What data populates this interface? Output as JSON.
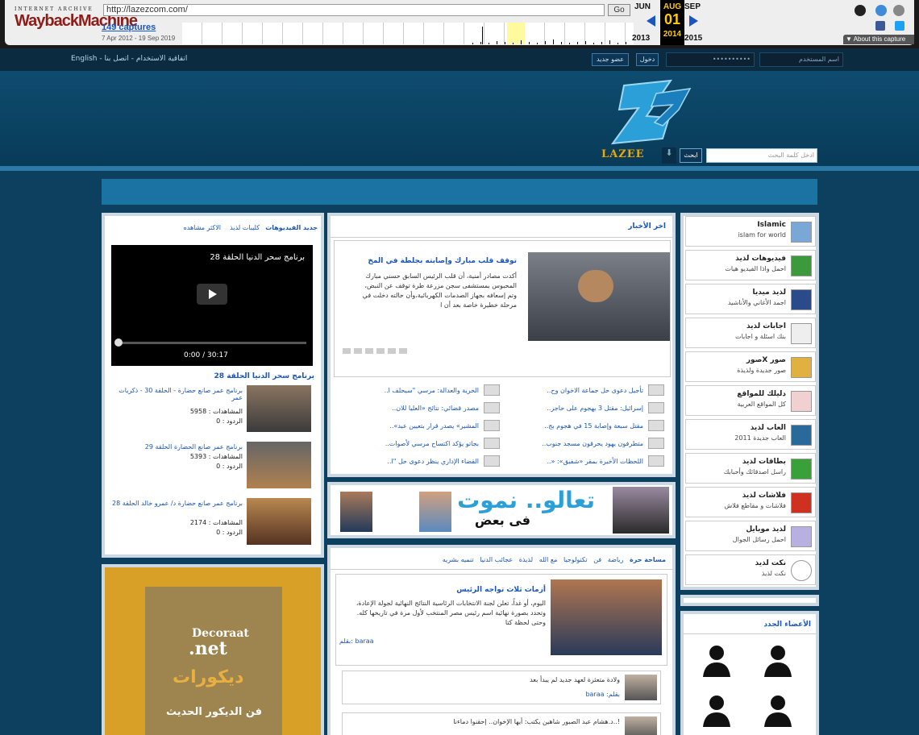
{
  "wayback": {
    "logo_top": "INTERNET ARCHIVE",
    "logo_main": "WaybackMachine",
    "url": "http://lazezcom.com/",
    "go_label": "Go",
    "captures": "149 captures",
    "date_range": "7 Apr 2012 - 19 Sep 2019",
    "month_prev": "JUN",
    "month_cur": "AUG",
    "month_next": "SEP",
    "day": "01",
    "year_prev": "2013",
    "year_cur": "2014",
    "year_next": "2015",
    "about": "▼ About this capture"
  },
  "topbar": {
    "links": "English - اتفاقية الاستخدام - اتصل بنا",
    "username_placeholder": "اسم المستخدم",
    "password_value": "••••••••••",
    "login_label": "دخول",
    "register_label": "عضو جديد"
  },
  "header": {
    "logo_text": "LAZEE",
    "search_placeholder": "ادخل كلمة البحث",
    "search_button": "ابحث"
  },
  "videos": {
    "tabs": [
      "جديد الفيديوهات",
      "كليبات لذيذ",
      "الاكثر مشاهده"
    ],
    "player_title": "برنامج سحر الدنيا الحلقة 28",
    "player_time": "0:00 / 30:17",
    "main_title": "برنامج سحر الدنيا الحلقة 28",
    "items": [
      {
        "title": "برنامج عمر صانع حضارة - الحلقة 30 - ذكريات عمر",
        "views": "المشاهدات : 5958",
        "replies": "الردود : 0"
      },
      {
        "title": "برنامج عمر صانع الحضارة الحلقة 29",
        "views": "المشاهدات : 5393",
        "replies": "الردود : 0"
      },
      {
        "title": "برنامج عمر صانع حضارة د/ عمرو خالد الحلقة 28",
        "views": "المشاهدات : 2174",
        "replies": "الردود : 0"
      }
    ]
  },
  "news": {
    "tab": "اخر الأخبار",
    "headline": "توقف قلب مبارك وإصابته بجلطة في المخ",
    "body": "أكدت مصادر أمنية، أن قلب الرئيس السابق حسني مبارك المحبوس بمستشفى سجن مزرعة طرة توقف عن النبض، وتم إسعافه بجهاز الصدمات الكهربائية،وأن حالته دخلت في مرحلة خطيرة خاصة بعد أن ا",
    "list_right": [
      "تأجيل دعوى حل جماعة الاخوان وح..",
      "إسرائيل: مقتل 3 بهجوم على حاجز..",
      "مقتل سبعة وإصابة 15 في هجوم بج..",
      "متطرفون يهود يحرقون مسجد جنوب..",
      "اللحظات الأخيرة بمقر «شفيق»: «.."
    ],
    "list_left": [
      "الحرية والعدالة: مرسي \"سيحلف ا..",
      "مصدر قضائي: نتائج «العليا للان..",
      "المشير» يصدر قرار بتعيين عبد»..",
      "بجاتو يؤكد اكتساح مرسي لأصوات..",
      "القضاء الإداري ينظر دعوى حل \"ا.."
    ]
  },
  "banner": {
    "text_big": "تعالو.. نموت",
    "text_small": "فى بعض"
  },
  "articles": {
    "tabs": [
      "مساحة حرة",
      "رياضة",
      "فن",
      "تكنولوجيا",
      "مع الله",
      "لذيذة",
      "عجائب الدنيا",
      "تنميه بشريه"
    ],
    "headline": "أزمات ثلاث تواجه الرئيس",
    "body": "اليوم، أو غداً، تعلن لجنة الانتخابات الرئاسية النتائج النهائية لجولة الإعادة، وتحدد بصورة نهائية اسم رئيس مصر المنتخب لأول مرة في تاريخها كله. وحتى لحظة كتا",
    "author": "بقلم: baraa",
    "item1": "ولادة متعثرة لعهد جديد لم يبدأ بعد",
    "item1_author": "بقلم: baraa",
    "item2": "!..د.هشام عبد الصبور شاهين يكتب: أيها الإخوان.. إحقنوا دماءنا"
  },
  "sidebar": {
    "items": [
      {
        "title": "Islamic",
        "sub": "islam for world",
        "icon": "globe-icon"
      },
      {
        "title": "فيديوهات لذيذ",
        "sub": "احمل واذا الفيديو هيات",
        "icon": "play-icon"
      },
      {
        "title": "لذيذ ميديا",
        "sub": "اجمد الأغاني والأناشيد",
        "icon": "music-icon"
      },
      {
        "title": "اجابات لذيذ",
        "sub": "بنك اسئلة و اجابات",
        "icon": "question-icon"
      },
      {
        "title": "صور Xصور",
        "sub": "صور جديدة ولذيذة",
        "icon": "photos-icon"
      },
      {
        "title": "دليلك للمواقع",
        "sub": "كل المواقع العربية",
        "icon": "search-icon"
      },
      {
        "title": "العاب لذيذ",
        "sub": "العاب جديدة 2011",
        "icon": "dice-icon"
      },
      {
        "title": "بطاقات لذيذ",
        "sub": "راسل اصدقائك وأحبابك",
        "icon": "card-icon"
      },
      {
        "title": "فلاشات لذيذ",
        "sub": "فلاشات و مقاطع فلاش",
        "icon": "flash-icon"
      },
      {
        "title": "لذيذ موبايل",
        "sub": "احمل رسائل الجوال",
        "icon": "mobile-icon"
      },
      {
        "title": "نكت لذيذ",
        "sub": "نكت لذيذ",
        "icon": "smile-icon"
      }
    ],
    "members_title": "الأعضاء الجدد"
  },
  "ad": {
    "brand_top": "Decoraat",
    "brand_net": ".net",
    "arabic": "ديكورات",
    "tagline": "فن الديكور الحديث"
  },
  "colors": {
    "accent": "#1a55c0",
    "header_bg": "#0e4c6f",
    "logo": "#f0a800"
  }
}
